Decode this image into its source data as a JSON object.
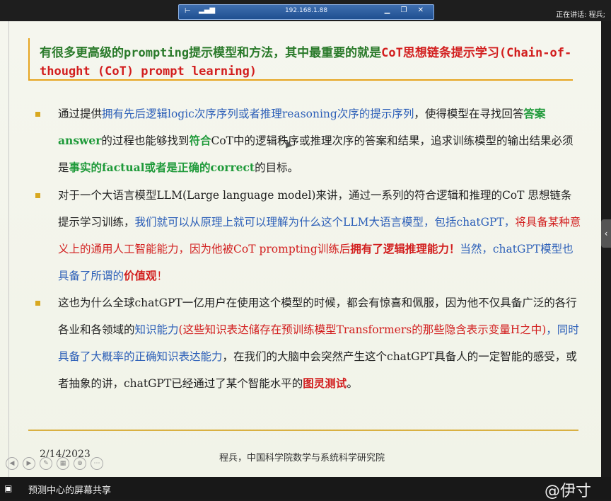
{
  "window": {
    "remote_ip": "192.168.1.88",
    "speaking_label": "正在讲话: 程兵;"
  },
  "slide": {
    "title_parts": [
      {
        "text": "有很多更高级的prompting提示模型和方法，其中最重要的就是",
        "style": ""
      },
      {
        "text": "CoT思想链条提示学习(Chain-of-thought (CoT) prompt learning)",
        "style": "red"
      }
    ],
    "bullets": [
      [
        {
          "text": "通过提供",
          "style": ""
        },
        {
          "text": "拥有先后逻辑logic次序序列或者推理reasoning次序的提示序列",
          "style": "blue"
        },
        {
          "text": "，使得模型在寻找回答",
          "style": ""
        },
        {
          "text": "答案answer",
          "style": "green"
        },
        {
          "text": "的过程也能够找到",
          "style": ""
        },
        {
          "text": "符合",
          "style": "green"
        },
        {
          "text": "CoT中的逻辑秩序或推理次序的答案和结果，追求训练模型的输出结果必须是",
          "style": ""
        },
        {
          "text": "事实的factual或者是正确的correct",
          "style": "green"
        },
        {
          "text": "的目标。",
          "style": ""
        }
      ],
      [
        {
          "text": "对于一个大语言模型LLM(Large language model)来讲，通过一系列的符合逻辑和推理的CoT 思想链条提示学习训练，",
          "style": ""
        },
        {
          "text": "我们就可以从原理上就可以理解为什么这个LLM大语言模型，包括chatGPT，",
          "style": "blue"
        },
        {
          "text": "将具备某种意义上的通用人工智能能力，因为他被CoT prompting训练后",
          "style": "red"
        },
        {
          "text": "拥有了逻辑推理能力！",
          "style": "red bold"
        },
        {
          "text": "当然，chatGPT模型也具备了所谓的",
          "style": "blue"
        },
        {
          "text": "价值观",
          "style": "red bold"
        },
        {
          "text": "！",
          "style": "red"
        }
      ],
      [
        {
          "text": "这也为什么全球chatGPT一亿用户在使用这个模型的时候，都会有惊喜和佩服，因为他不仅具备广泛的各行各业和各领域的",
          "style": ""
        },
        {
          "text": "知识能力",
          "style": "blue"
        },
        {
          "text": "(这些知识表达储存在预训练模型Transformers的那些隐含表示变量H之中)",
          "style": "red"
        },
        {
          "text": "，同时具备了大概率的正确知识表达能力",
          "style": "blue"
        },
        {
          "text": "，在我们的大脑中会突然产生这个chatGPT具备人的一定智能的感受，或者抽象的讲，chatGPT已经通过了某个智能水平的",
          "style": ""
        },
        {
          "text": "图灵测试",
          "style": "red bold"
        },
        {
          "text": "。",
          "style": ""
        }
      ]
    ],
    "date": "2/14/2023",
    "author": "程兵，中国科学院数学与系统科学研究院"
  },
  "bottom": {
    "share_label": "预测中心的屏幕共享",
    "watermark": "@伊寸"
  },
  "colors": {
    "title_green": "#2a7a2a",
    "red": "#d21e1e",
    "blue": "#2c5fb8",
    "green": "#1f9a3a",
    "accent_gold": "#d9b042"
  }
}
